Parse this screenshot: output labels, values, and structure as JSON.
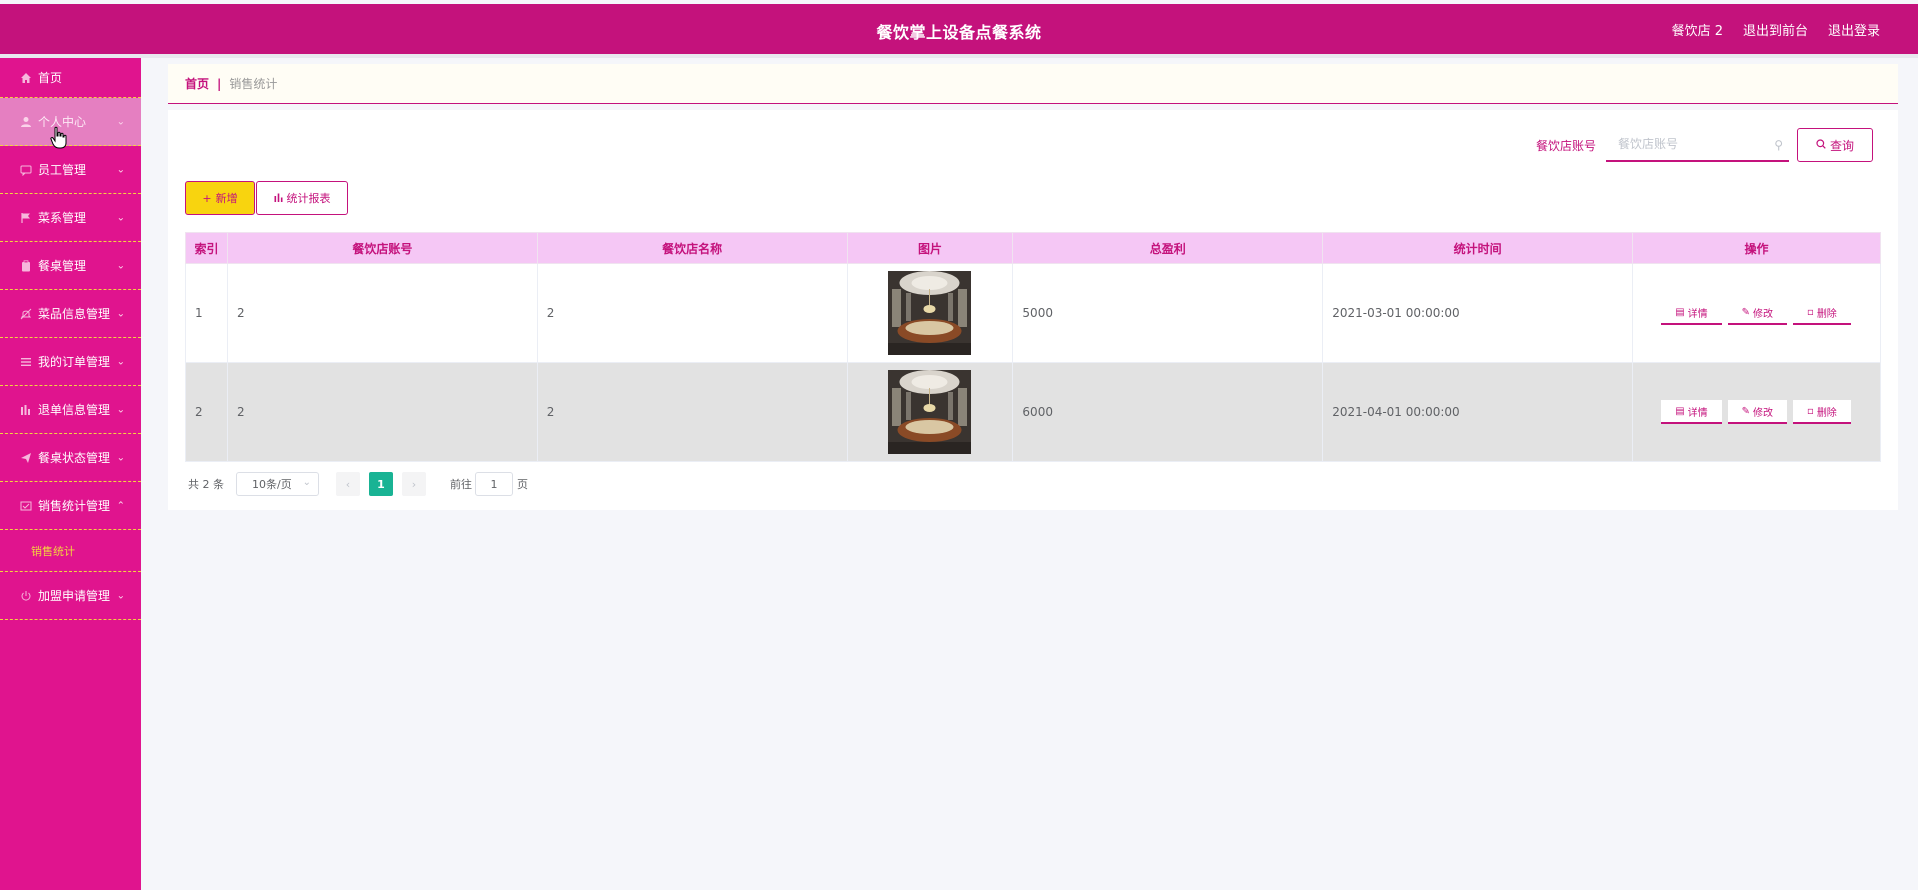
{
  "header": {
    "title": "餐饮掌上设备点餐系统",
    "user": "餐饮店 2",
    "to_front": "退出到前台",
    "logout": "退出登录",
    "color": "#c4127c"
  },
  "sidebar": {
    "color": "#e0148e",
    "items": [
      {
        "label": "首页",
        "icon": "home-icon"
      },
      {
        "label": "个人中心",
        "icon": "user-icon"
      },
      {
        "label": "员工管理",
        "icon": "chat-icon"
      },
      {
        "label": "菜系管理",
        "icon": "flag-icon"
      },
      {
        "label": "餐桌管理",
        "icon": "clipboard-icon"
      },
      {
        "label": "菜品信息管理",
        "icon": "bell-off-icon"
      },
      {
        "label": "我的订单管理",
        "icon": "list-icon"
      },
      {
        "label": "退单信息管理",
        "icon": "bar-chart-icon"
      },
      {
        "label": "餐桌状态管理",
        "icon": "send-icon"
      },
      {
        "label": "销售统计管理",
        "icon": "mail-check-icon"
      },
      {
        "label": "加盟申请管理",
        "icon": "power-icon"
      }
    ],
    "submenu_active": "销售统计"
  },
  "breadcrumb": {
    "home": "首页",
    "sep": "|",
    "current": "销售统计"
  },
  "search": {
    "label": "餐饮店账号",
    "placeholder": "餐饮店账号",
    "button": "查询"
  },
  "actions": {
    "add": "新增",
    "report": "统计报表"
  },
  "table": {
    "columns": [
      "索引",
      "餐饮店账号",
      "餐饮店名称",
      "图片",
      "总盈利",
      "统计时间",
      "操作"
    ],
    "rows": [
      {
        "index": "1",
        "account": "2",
        "name": "2",
        "profit": "5000",
        "time": "2021-03-01 00:00:00"
      },
      {
        "index": "2",
        "account": "2",
        "name": "2",
        "profit": "6000",
        "time": "2021-04-01 00:00:00"
      }
    ],
    "ops": {
      "detail": "详情",
      "edit": "修改",
      "delete": "删除"
    }
  },
  "pagination": {
    "total": "共 2 条",
    "page_size": "10条/页",
    "current_page": "1",
    "goto_label": "前往",
    "goto_value": "1",
    "page_unit": "页",
    "active_color": "#19b394"
  }
}
